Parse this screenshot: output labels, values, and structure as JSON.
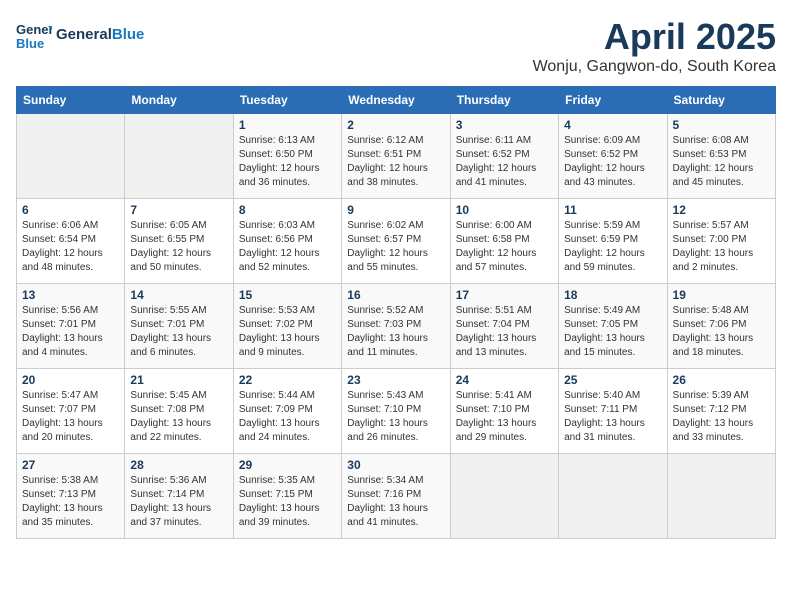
{
  "header": {
    "logo_line1": "General",
    "logo_line2": "Blue",
    "title": "April 2025",
    "subtitle": "Wonju, Gangwon-do, South Korea"
  },
  "days_of_week": [
    "Sunday",
    "Monday",
    "Tuesday",
    "Wednesday",
    "Thursday",
    "Friday",
    "Saturday"
  ],
  "weeks": [
    [
      {
        "day": "",
        "info": ""
      },
      {
        "day": "",
        "info": ""
      },
      {
        "day": "1",
        "info": "Sunrise: 6:13 AM\nSunset: 6:50 PM\nDaylight: 12 hours\nand 36 minutes."
      },
      {
        "day": "2",
        "info": "Sunrise: 6:12 AM\nSunset: 6:51 PM\nDaylight: 12 hours\nand 38 minutes."
      },
      {
        "day": "3",
        "info": "Sunrise: 6:11 AM\nSunset: 6:52 PM\nDaylight: 12 hours\nand 41 minutes."
      },
      {
        "day": "4",
        "info": "Sunrise: 6:09 AM\nSunset: 6:52 PM\nDaylight: 12 hours\nand 43 minutes."
      },
      {
        "day": "5",
        "info": "Sunrise: 6:08 AM\nSunset: 6:53 PM\nDaylight: 12 hours\nand 45 minutes."
      }
    ],
    [
      {
        "day": "6",
        "info": "Sunrise: 6:06 AM\nSunset: 6:54 PM\nDaylight: 12 hours\nand 48 minutes."
      },
      {
        "day": "7",
        "info": "Sunrise: 6:05 AM\nSunset: 6:55 PM\nDaylight: 12 hours\nand 50 minutes."
      },
      {
        "day": "8",
        "info": "Sunrise: 6:03 AM\nSunset: 6:56 PM\nDaylight: 12 hours\nand 52 minutes."
      },
      {
        "day": "9",
        "info": "Sunrise: 6:02 AM\nSunset: 6:57 PM\nDaylight: 12 hours\nand 55 minutes."
      },
      {
        "day": "10",
        "info": "Sunrise: 6:00 AM\nSunset: 6:58 PM\nDaylight: 12 hours\nand 57 minutes."
      },
      {
        "day": "11",
        "info": "Sunrise: 5:59 AM\nSunset: 6:59 PM\nDaylight: 12 hours\nand 59 minutes."
      },
      {
        "day": "12",
        "info": "Sunrise: 5:57 AM\nSunset: 7:00 PM\nDaylight: 13 hours\nand 2 minutes."
      }
    ],
    [
      {
        "day": "13",
        "info": "Sunrise: 5:56 AM\nSunset: 7:01 PM\nDaylight: 13 hours\nand 4 minutes."
      },
      {
        "day": "14",
        "info": "Sunrise: 5:55 AM\nSunset: 7:01 PM\nDaylight: 13 hours\nand 6 minutes."
      },
      {
        "day": "15",
        "info": "Sunrise: 5:53 AM\nSunset: 7:02 PM\nDaylight: 13 hours\nand 9 minutes."
      },
      {
        "day": "16",
        "info": "Sunrise: 5:52 AM\nSunset: 7:03 PM\nDaylight: 13 hours\nand 11 minutes."
      },
      {
        "day": "17",
        "info": "Sunrise: 5:51 AM\nSunset: 7:04 PM\nDaylight: 13 hours\nand 13 minutes."
      },
      {
        "day": "18",
        "info": "Sunrise: 5:49 AM\nSunset: 7:05 PM\nDaylight: 13 hours\nand 15 minutes."
      },
      {
        "day": "19",
        "info": "Sunrise: 5:48 AM\nSunset: 7:06 PM\nDaylight: 13 hours\nand 18 minutes."
      }
    ],
    [
      {
        "day": "20",
        "info": "Sunrise: 5:47 AM\nSunset: 7:07 PM\nDaylight: 13 hours\nand 20 minutes."
      },
      {
        "day": "21",
        "info": "Sunrise: 5:45 AM\nSunset: 7:08 PM\nDaylight: 13 hours\nand 22 minutes."
      },
      {
        "day": "22",
        "info": "Sunrise: 5:44 AM\nSunset: 7:09 PM\nDaylight: 13 hours\nand 24 minutes."
      },
      {
        "day": "23",
        "info": "Sunrise: 5:43 AM\nSunset: 7:10 PM\nDaylight: 13 hours\nand 26 minutes."
      },
      {
        "day": "24",
        "info": "Sunrise: 5:41 AM\nSunset: 7:10 PM\nDaylight: 13 hours\nand 29 minutes."
      },
      {
        "day": "25",
        "info": "Sunrise: 5:40 AM\nSunset: 7:11 PM\nDaylight: 13 hours\nand 31 minutes."
      },
      {
        "day": "26",
        "info": "Sunrise: 5:39 AM\nSunset: 7:12 PM\nDaylight: 13 hours\nand 33 minutes."
      }
    ],
    [
      {
        "day": "27",
        "info": "Sunrise: 5:38 AM\nSunset: 7:13 PM\nDaylight: 13 hours\nand 35 minutes."
      },
      {
        "day": "28",
        "info": "Sunrise: 5:36 AM\nSunset: 7:14 PM\nDaylight: 13 hours\nand 37 minutes."
      },
      {
        "day": "29",
        "info": "Sunrise: 5:35 AM\nSunset: 7:15 PM\nDaylight: 13 hours\nand 39 minutes."
      },
      {
        "day": "30",
        "info": "Sunrise: 5:34 AM\nSunset: 7:16 PM\nDaylight: 13 hours\nand 41 minutes."
      },
      {
        "day": "",
        "info": ""
      },
      {
        "day": "",
        "info": ""
      },
      {
        "day": "",
        "info": ""
      }
    ]
  ]
}
